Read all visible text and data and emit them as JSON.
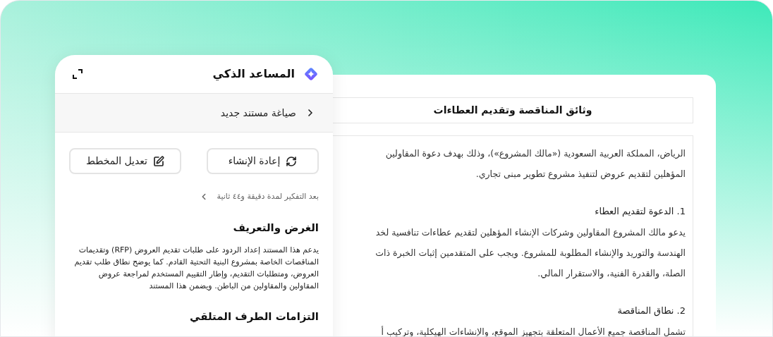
{
  "assistant": {
    "title": "المساعد الذكي",
    "breadcrumb": "صياغة مستند جديد",
    "buttons": [
      {
        "kind": "regenerate",
        "label": "إعادة الإنشاء"
      },
      {
        "kind": "edit",
        "label": "تعديل المخطط"
      }
    ],
    "thinking": "بعد التفكير لمدة دقيقة و٤٤ ثانية",
    "sections": [
      {
        "kind": "heading",
        "text": "الغرض والتعريف"
      },
      {
        "kind": "paragraph",
        "text": "يدعم هذا المستند إعداد الردود على طلبات تقديم العروض (RFP) وتقديمات المناقصات الخاصة بمشروع البنية التحتية القادم. كما يوضح نطاق طلب تقديم العروض، ومتطلبات التقديم، وإطار التقييم المستخدم لمراجعة عروض المقاولين والمقاولين من الباطن. ويضمن هذا المستند"
      },
      {
        "kind": "heading",
        "text": "التزامات الطرف المتلقي"
      }
    ]
  },
  "document": {
    "title": "وثائق المناقصة وتقديم العطاءات",
    "blocks": [
      {
        "kind": "paragraph",
        "lines": [
          "الرياض، المملكة العربية السعودية («مالك المشروع»)، وذلك بهدف دعوة المقاولين",
          "المؤهلين لتقديم عروض لتنفيذ مشروع تطوير مبنى تجاري."
        ]
      },
      {
        "kind": "heading",
        "lines": [
          "1. الدعوة لتقديم العطاء"
        ]
      },
      {
        "kind": "paragraph",
        "lines": [
          "يدعو مالك المشروع المقاولين وشركات الإنشاء المؤهلين لتقديم عطاءات تنافسية لخد",
          "الهندسة والتوريد والإنشاء المطلوبة للمشروع. ويجب على المتقدمين إثبات الخبرة ذات",
          "الصلة، والقدرة الفنية، والاستقرار المالي."
        ]
      },
      {
        "kind": "heading",
        "lines": [
          "2. نطاق المناقصة"
        ]
      },
      {
        "kind": "paragraph",
        "lines": [
          "تشمل المناقصة جميع الأعمال المتعلقة بتجهيز الموقع، والإنشاءات الهيكلية، وتركيب أ"
        ]
      }
    ]
  }
}
